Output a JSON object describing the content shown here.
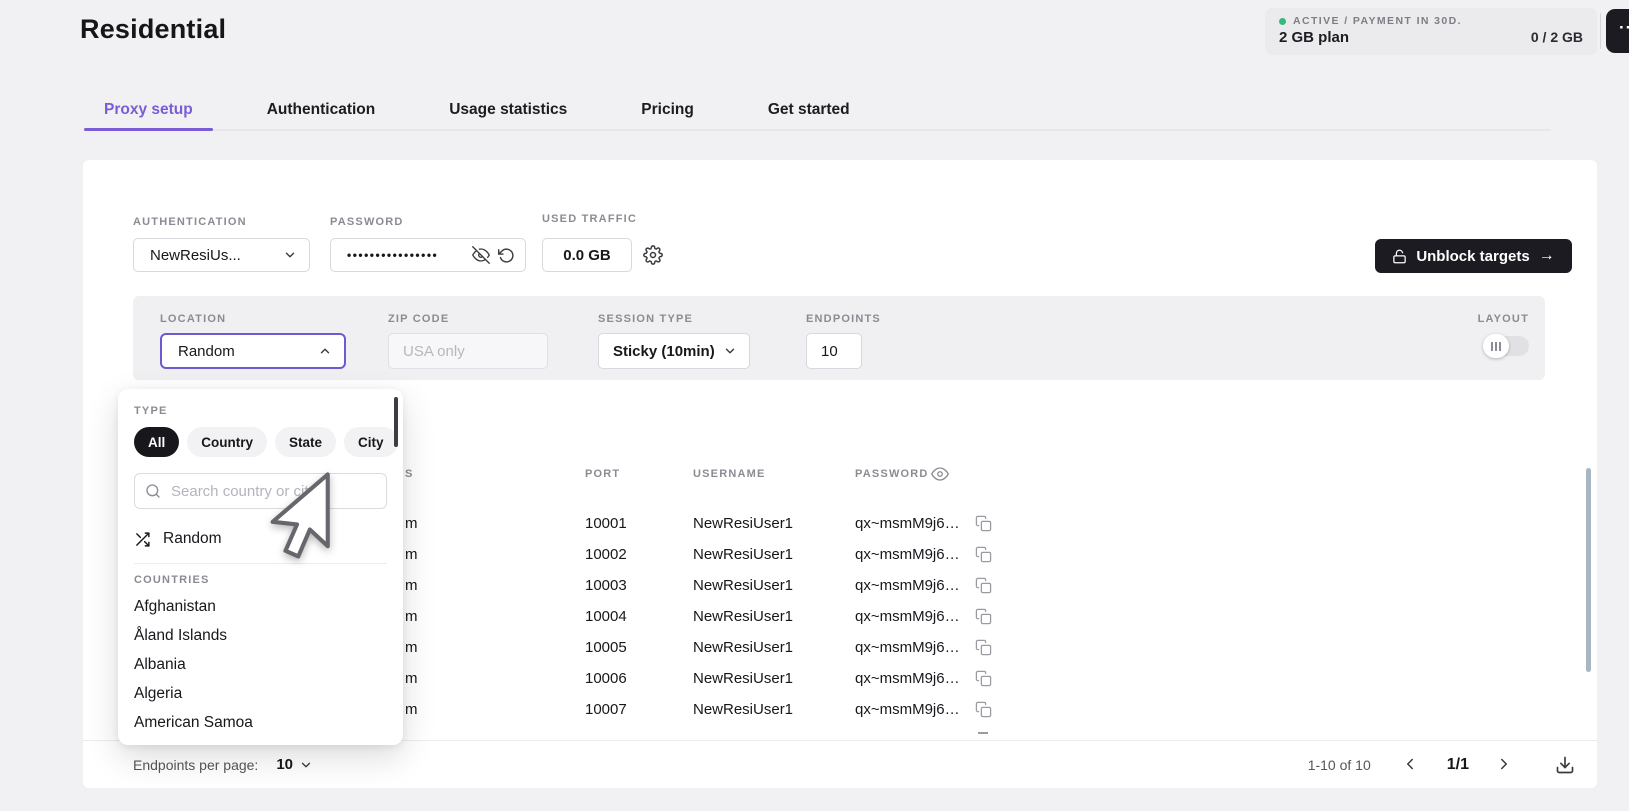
{
  "page": {
    "title": "Residential"
  },
  "plan_badge": {
    "status": "ACTIVE / PAYMENT IN 30D.",
    "plan": "2 GB plan",
    "usage": "0 / 2 GB",
    "menu": "···",
    "status_color": "#35b97e"
  },
  "tabs": [
    {
      "label": "Proxy setup",
      "active": true
    },
    {
      "label": "Authentication",
      "active": false
    },
    {
      "label": "Usage statistics",
      "active": false
    },
    {
      "label": "Pricing",
      "active": false
    },
    {
      "label": "Get started",
      "active": false
    }
  ],
  "form": {
    "authentication": {
      "label": "AUTHENTICATION",
      "value": "NewResiUs..."
    },
    "password": {
      "label": "PASSWORD",
      "masked": "••••••••••••••••"
    },
    "used_traffic": {
      "label": "USED TRAFFIC",
      "value": "0.0 GB"
    },
    "unblock_button": {
      "label": "Unblock targets",
      "arrow": "→"
    }
  },
  "filters": {
    "location": {
      "label": "LOCATION",
      "value": "Random"
    },
    "zip": {
      "label": "ZIP CODE",
      "placeholder": "USA only"
    },
    "session_type": {
      "label": "SESSION TYPE",
      "value": "Sticky (10min)"
    },
    "endpoints": {
      "label": "ENDPOINTS",
      "value": "10"
    },
    "layout": {
      "label": "LAYOUT"
    }
  },
  "location_dropdown": {
    "type_label": "TYPE",
    "type_options": [
      "All",
      "Country",
      "State",
      "City"
    ],
    "active_type": "All",
    "search_placeholder": "Search country or city",
    "random_option": "Random",
    "countries_label": "COUNTRIES",
    "countries": [
      "Afghanistan",
      "Åland Islands",
      "Albania",
      "Algeria",
      "American Samoa"
    ]
  },
  "table": {
    "headers": {
      "endpoint_fragment": "S",
      "port": "PORT",
      "username": "USERNAME",
      "password": "PASSWORD"
    },
    "rows": [
      {
        "endpoint_fragment": "m",
        "port": "10001",
        "username": "NewResiUser1",
        "password": "qx~msmM9j6…"
      },
      {
        "endpoint_fragment": "m",
        "port": "10002",
        "username": "NewResiUser1",
        "password": "qx~msmM9j6…"
      },
      {
        "endpoint_fragment": "m",
        "port": "10003",
        "username": "NewResiUser1",
        "password": "qx~msmM9j6…"
      },
      {
        "endpoint_fragment": "m",
        "port": "10004",
        "username": "NewResiUser1",
        "password": "qx~msmM9j6…"
      },
      {
        "endpoint_fragment": "m",
        "port": "10005",
        "username": "NewResiUser1",
        "password": "qx~msmM9j6…"
      },
      {
        "endpoint_fragment": "m",
        "port": "10006",
        "username": "NewResiUser1",
        "password": "qx~msmM9j6…"
      },
      {
        "endpoint_fragment": "m",
        "port": "10007",
        "username": "NewResiUser1",
        "password": "qx~msmM9j6…"
      }
    ]
  },
  "footer": {
    "per_page_label": "Endpoints per page:",
    "per_page_value": "10",
    "range": "1-10 of 10",
    "page": "1/1"
  },
  "colors": {
    "accent_purple": "#7a5cd6",
    "dark_button": "#1b1b21",
    "status_green": "#35b97e",
    "page_bg": "#f1f1f3"
  }
}
